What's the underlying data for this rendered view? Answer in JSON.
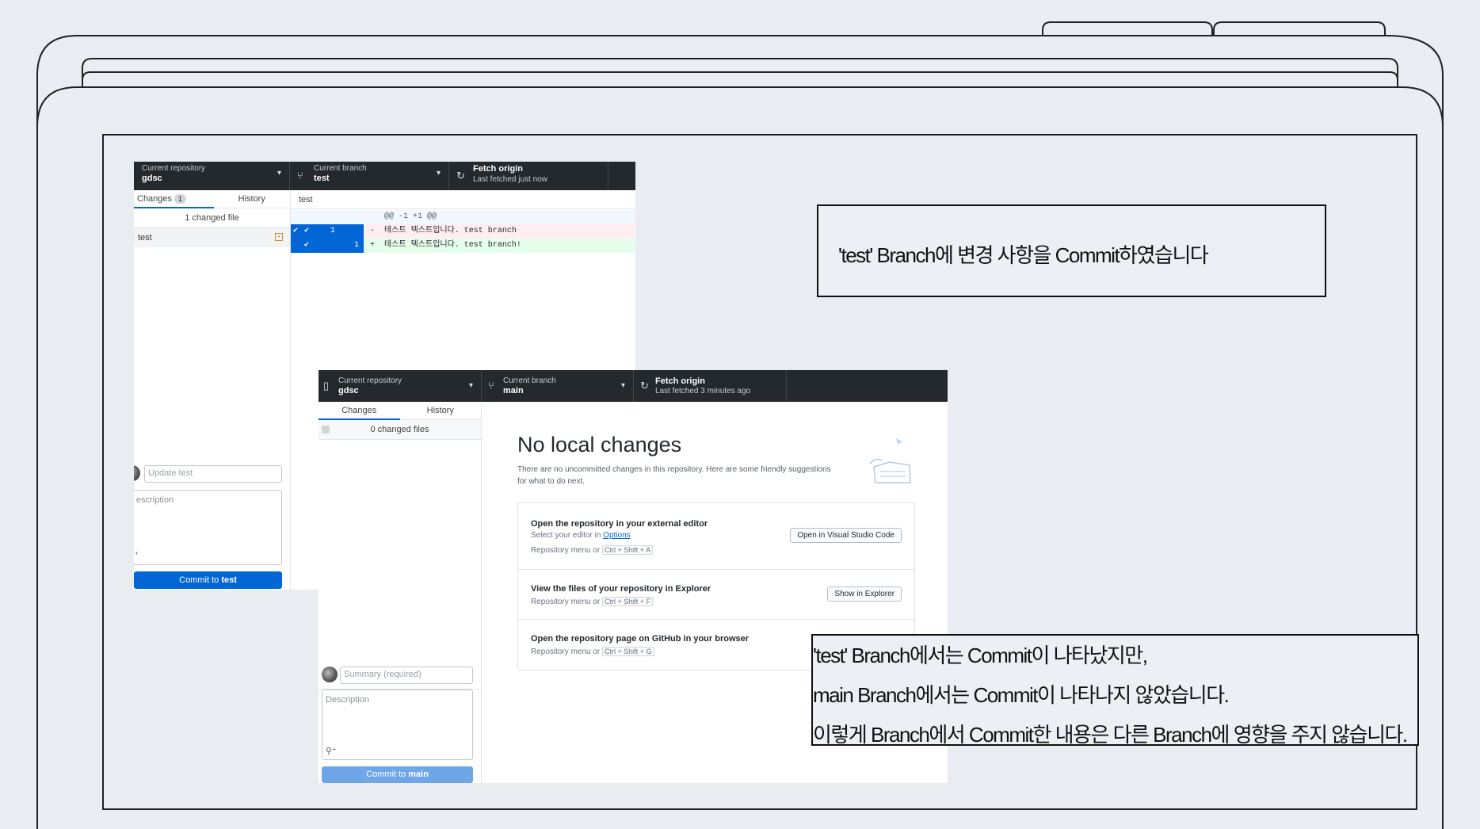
{
  "window_back": {
    "toolbar": {
      "repo_label": "Current repository",
      "repo_name": "gdsc",
      "branch_label": "Current branch",
      "branch_name": "test",
      "fetch_title": "Fetch origin",
      "fetch_sub": "Last fetched just now"
    },
    "tabs": {
      "changes": "Changes",
      "changes_count": "1",
      "history": "History"
    },
    "changed_files_header": "1 changed file",
    "file_name": "test",
    "diff": {
      "file_header": "test",
      "hunk": "@@ -1 +1 @@",
      "old_line_no": "1",
      "new_line_no": "1",
      "removed": "-  테스트 텍스트입니다. test branch",
      "added": "+  테스트 텍스트입니다. test branch!"
    },
    "summary_placeholder": "Update test",
    "description_placeholder": "escription",
    "commit_prefix": "Commit to ",
    "commit_branch": "test"
  },
  "window_front": {
    "toolbar": {
      "repo_label": "Current repository",
      "repo_name": "gdsc",
      "branch_label": "Current branch",
      "branch_name": "main",
      "fetch_title": "Fetch origin",
      "fetch_sub": "Last fetched 3 minutes ago"
    },
    "tabs": {
      "changes": "Changes",
      "history": "History"
    },
    "changed_files_header": "0 changed files",
    "heading": "No local changes",
    "subtext_line1": "There are no uncommitted changes in this repository. Here are some friendly suggestions",
    "subtext_line2": "for what to do next.",
    "cards": [
      {
        "title": "Open the repository in your external editor",
        "sub_prefix": "Select your editor in ",
        "sub_link": "Options",
        "shortcut_prefix": "Repository menu or ",
        "shortcut": "Ctrl + Shift + A",
        "button": "Open in Visual Studio Code"
      },
      {
        "title": "View the files of your repository in Explorer",
        "shortcut_prefix": "Repository menu or ",
        "shortcut": "Ctrl + Shift + F",
        "button": "Show in Explorer"
      },
      {
        "title": "Open the repository page on GitHub in your browser",
        "shortcut_prefix": "Repository menu or ",
        "shortcut": "Ctrl + Shift + G"
      }
    ],
    "summary_placeholder": "Summary (required)",
    "description_placeholder": "Description",
    "commit_prefix": "Commit to ",
    "commit_branch": "main"
  },
  "notes": {
    "note1": "'test' Branch에 변경 사항을 Commit하였습니다",
    "note2_line1": "'test' Branch에서는 Commit이 나타났지만,",
    "note2_line2": "main Branch에서는 Commit이 나타나지 않았습니다.",
    "note2_line3": "이렇게 Branch에서 Commit한 내용은 다른 Branch에 영향을 주지 않습니다."
  },
  "colors": {
    "toolbar": "#24292e",
    "accent": "#0366d6",
    "added": "#e6ffed",
    "removed": "#ffeef0"
  }
}
